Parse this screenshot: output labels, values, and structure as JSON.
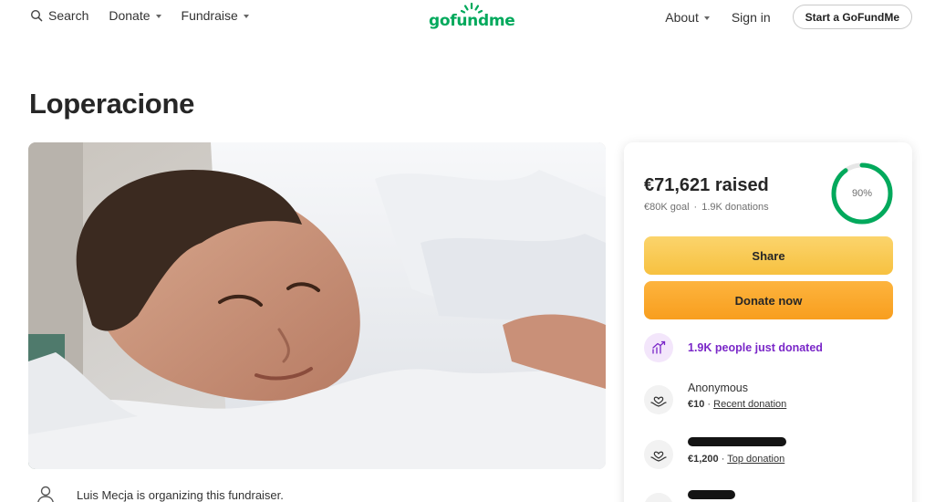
{
  "header": {
    "search_label": "Search",
    "donate_label": "Donate",
    "fundraise_label": "Fundraise",
    "logo_text": "gofundme",
    "about_label": "About",
    "signin_label": "Sign in",
    "start_label": "Start a GoFundMe"
  },
  "campaign": {
    "title": "Loperacione",
    "organizer_text": "Luis Mecja is organizing this fundraiser."
  },
  "donation_card": {
    "raised_text": "€71,621 raised",
    "goal_text": "€80K goal",
    "donations_text": "1.9K donations",
    "progress_label": "90%",
    "progress_fraction": 0.9,
    "share_label": "Share",
    "donate_label": "Donate now",
    "trend_text": "1.9K people just donated",
    "donations": [
      {
        "name": "Anonymous",
        "amount": "€10",
        "tag": "Recent donation",
        "name_redacted": false
      },
      {
        "name": "",
        "amount": "€1,200",
        "tag": "Top donation",
        "name_redacted": true
      },
      {
        "name": "",
        "amount": "",
        "tag": "",
        "name_redacted": true
      }
    ]
  },
  "colors": {
    "brand_green": "#02a95c",
    "share_yellow": "#f7c140",
    "donate_orange": "#f89e1e",
    "trend_purple": "#7a27c8"
  },
  "icons": {
    "search": "search-icon",
    "organizer": "user-icon",
    "trend": "trending-up-icon",
    "donor": "heart-hands-icon"
  }
}
